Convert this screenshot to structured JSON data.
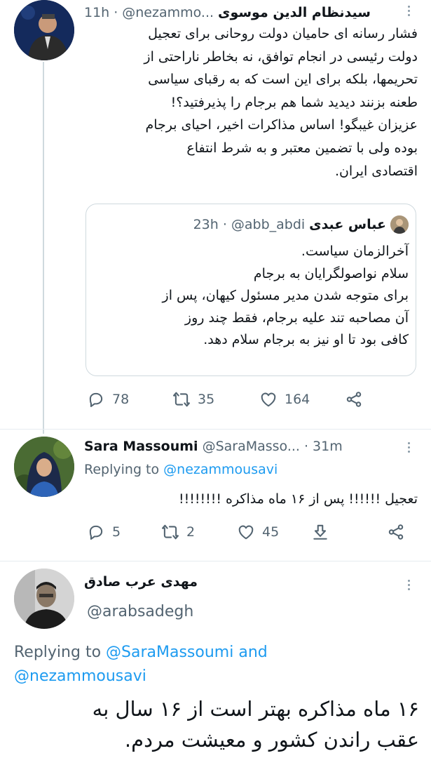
{
  "tweet1": {
    "display_name": "سیدنظام الدین موسوی",
    "handle": "@nezammo...",
    "time": "11h",
    "lines": [
      "فشار رسانه ای حامیان دولت روحانی برای تعجیل",
      "دولت رئیسی در انجام توافق، نه بخاطر ناراحتی از",
      "تحریمها، بلکه برای این است که به رقبای سیاسی",
      "طعنه بزنند دیدید شما هم برجام را پذیرفتید؟!",
      "عزیزان غیبگو! اساس مذاکرات اخیر، احیای برجام",
      "بوده ولی با تضمین معتبر و به شرط انتفاع",
      "اقتصادی ایران."
    ],
    "quote": {
      "display_name": "عباس عبدی",
      "handle": "@abb_abdi",
      "time": "23h",
      "lines": [
        "آخرالزمان سیاست.",
        "سلام نواصولگرایان به برجام",
        "برای متوجه شدن مدیر مسئول کیهان، پس از",
        "آن مصاحبه تند علیه برجام، فقط چند روز",
        "کافی بود تا او نیز به برجام سلام دهد."
      ]
    },
    "actions": {
      "replies": "78",
      "retweets": "35",
      "likes": "164"
    }
  },
  "tweet2": {
    "display_name": "Sara Massoumi",
    "handle": "@SaraMasso...",
    "time": "31m",
    "replying_prefix": "Replying to",
    "replying_to": "@nezammousavi",
    "text": "تعجیل !!!!!! پس از ۱۶ ماه مذاکره !!!!!!!!",
    "actions": {
      "replies": "5",
      "retweets": "2",
      "likes": "45"
    }
  },
  "tweet3": {
    "display_name": "مهدی عرب صادق",
    "handle": "@arabsadegh",
    "replying_prefix": "Replying to",
    "replying_to_1": "@SaraMassoumi",
    "and_word": "and",
    "replying_to_2": "@nezammousavi",
    "lines": [
      "۱۶ ماه مذاکره بهتر است از ۱۶ سال به",
      "عقب راندن کشور و معیشت مردم."
    ]
  },
  "icons": {
    "reply": "reply-icon",
    "retweet": "retweet-icon",
    "like": "heart-icon",
    "share": "share-icon",
    "download": "download-icon",
    "more": "more-icon"
  },
  "colors": {
    "accent": "#1d9bf0",
    "text": "#0f1419",
    "muted": "#536471",
    "border": "#cfd9de"
  }
}
